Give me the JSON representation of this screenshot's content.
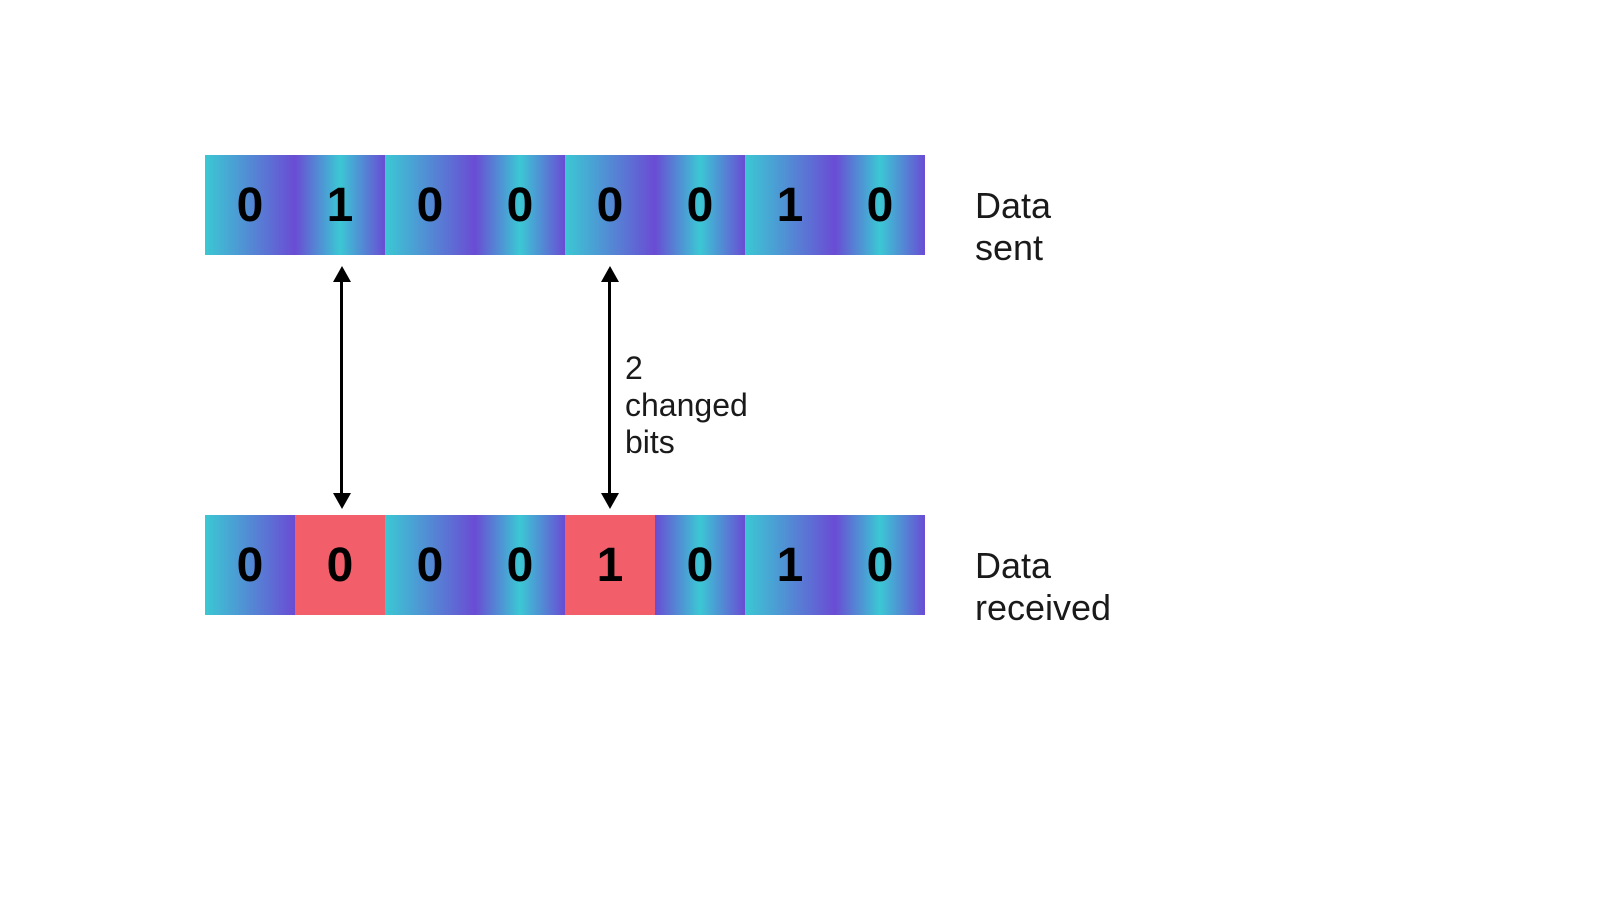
{
  "labels": {
    "sent": "Data sent",
    "received": "Data  received",
    "changed": "2 changed bits"
  },
  "bits_sent": [
    "0",
    "1",
    "0",
    "0",
    "0",
    "0",
    "1",
    "0"
  ],
  "bits_received": [
    "0",
    "0",
    "0",
    "0",
    "1",
    "0",
    "1",
    "0"
  ],
  "changed_indices": [
    1,
    4
  ],
  "colors": {
    "gradient_start": "#3bc8d4",
    "gradient_end": "#6a4cd4",
    "changed": "#f25f6a"
  }
}
